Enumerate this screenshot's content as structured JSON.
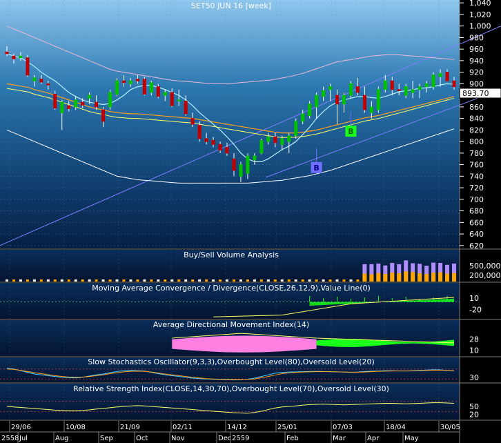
{
  "chart_data": {
    "type": "candlestick",
    "title": "SET50 JUN 16   [week]",
    "last_price_label": "893.70",
    "price_axis": {
      "ylim": [
        615,
        1045
      ],
      "ticks": [
        "1,040",
        "1,020",
        "1,000",
        "980",
        "960",
        "940",
        "920",
        "900",
        "880",
        "860",
        "840",
        "820",
        "800",
        "780",
        "760",
        "740",
        "720",
        "700",
        "680",
        "660",
        "640",
        "620"
      ],
      "tick_values": [
        1040,
        1020,
        1000,
        980,
        960,
        940,
        920,
        900,
        880,
        860,
        840,
        820,
        800,
        780,
        760,
        740,
        720,
        700,
        680,
        660,
        640,
        620
      ]
    },
    "x_axis": {
      "date_labels": [
        "29/06",
        "10/08",
        "21/09",
        "02/11",
        "14/12",
        "25/01",
        "07/03",
        "18/04",
        "30/05"
      ],
      "month_labels": [
        "Jul",
        "Aug",
        "Sep",
        "Oct",
        "Nov",
        "Dec",
        "2559",
        "Feb",
        "Mar",
        "Apr",
        "May"
      ],
      "year_label": "2558"
    },
    "candles": [
      {
        "o": 955,
        "h": 965,
        "l": 948,
        "c": 952
      },
      {
        "o": 948,
        "h": 952,
        "l": 935,
        "c": 943
      },
      {
        "o": 945,
        "h": 955,
        "l": 940,
        "c": 948
      },
      {
        "o": 945,
        "h": 950,
        "l": 912,
        "c": 915
      },
      {
        "o": 905,
        "h": 915,
        "l": 895,
        "c": 910
      },
      {
        "o": 908,
        "h": 915,
        "l": 900,
        "c": 903
      },
      {
        "o": 900,
        "h": 905,
        "l": 890,
        "c": 898
      },
      {
        "o": 882,
        "h": 888,
        "l": 855,
        "c": 858
      },
      {
        "o": 850,
        "h": 872,
        "l": 820,
        "c": 868
      },
      {
        "o": 862,
        "h": 870,
        "l": 852,
        "c": 857
      },
      {
        "o": 860,
        "h": 878,
        "l": 855,
        "c": 872
      },
      {
        "o": 868,
        "h": 875,
        "l": 858,
        "c": 863
      },
      {
        "o": 875,
        "h": 885,
        "l": 865,
        "c": 880
      },
      {
        "o": 868,
        "h": 880,
        "l": 855,
        "c": 860
      },
      {
        "o": 855,
        "h": 860,
        "l": 825,
        "c": 835
      },
      {
        "o": 860,
        "h": 890,
        "l": 855,
        "c": 885
      },
      {
        "o": 882,
        "h": 910,
        "l": 878,
        "c": 905
      },
      {
        "o": 905,
        "h": 915,
        "l": 895,
        "c": 902
      },
      {
        "o": 900,
        "h": 910,
        "l": 895,
        "c": 905
      },
      {
        "o": 908,
        "h": 915,
        "l": 900,
        "c": 905
      },
      {
        "o": 908,
        "h": 912,
        "l": 880,
        "c": 882
      },
      {
        "o": 885,
        "h": 905,
        "l": 880,
        "c": 902
      },
      {
        "o": 895,
        "h": 900,
        "l": 875,
        "c": 878
      },
      {
        "o": 880,
        "h": 890,
        "l": 870,
        "c": 885
      },
      {
        "o": 885,
        "h": 892,
        "l": 860,
        "c": 862
      },
      {
        "o": 870,
        "h": 890,
        "l": 862,
        "c": 872
      },
      {
        "o": 870,
        "h": 880,
        "l": 845,
        "c": 848
      },
      {
        "o": 840,
        "h": 850,
        "l": 825,
        "c": 830
      },
      {
        "o": 828,
        "h": 835,
        "l": 800,
        "c": 805
      },
      {
        "o": 805,
        "h": 815,
        "l": 795,
        "c": 800
      },
      {
        "o": 802,
        "h": 808,
        "l": 790,
        "c": 795
      },
      {
        "o": 795,
        "h": 800,
        "l": 780,
        "c": 785
      },
      {
        "o": 790,
        "h": 798,
        "l": 775,
        "c": 780
      },
      {
        "o": 770,
        "h": 780,
        "l": 740,
        "c": 750
      },
      {
        "o": 740,
        "h": 765,
        "l": 730,
        "c": 760
      },
      {
        "o": 745,
        "h": 780,
        "l": 735,
        "c": 775
      },
      {
        "o": 768,
        "h": 780,
        "l": 760,
        "c": 775
      },
      {
        "o": 780,
        "h": 805,
        "l": 778,
        "c": 802
      },
      {
        "o": 800,
        "h": 815,
        "l": 795,
        "c": 808
      },
      {
        "o": 808,
        "h": 815,
        "l": 790,
        "c": 798
      },
      {
        "o": 795,
        "h": 810,
        "l": 785,
        "c": 805
      },
      {
        "o": 800,
        "h": 815,
        "l": 780,
        "c": 810
      },
      {
        "o": 810,
        "h": 840,
        "l": 805,
        "c": 835
      },
      {
        "o": 835,
        "h": 855,
        "l": 830,
        "c": 848
      },
      {
        "o": 845,
        "h": 870,
        "l": 840,
        "c": 865
      },
      {
        "o": 860,
        "h": 885,
        "l": 840,
        "c": 880
      },
      {
        "o": 878,
        "h": 895,
        "l": 870,
        "c": 888
      },
      {
        "o": 890,
        "h": 900,
        "l": 870,
        "c": 895
      },
      {
        "o": 880,
        "h": 890,
        "l": 830,
        "c": 865
      },
      {
        "o": 865,
        "h": 885,
        "l": 850,
        "c": 880
      },
      {
        "o": 880,
        "h": 905,
        "l": 875,
        "c": 900
      },
      {
        "o": 895,
        "h": 910,
        "l": 880,
        "c": 885
      },
      {
        "o": 880,
        "h": 895,
        "l": 850,
        "c": 855
      },
      {
        "o": 850,
        "h": 870,
        "l": 840,
        "c": 860
      },
      {
        "o": 855,
        "h": 895,
        "l": 850,
        "c": 890
      },
      {
        "o": 890,
        "h": 915,
        "l": 885,
        "c": 905
      },
      {
        "o": 905,
        "h": 912,
        "l": 880,
        "c": 890
      },
      {
        "o": 890,
        "h": 900,
        "l": 880,
        "c": 888
      },
      {
        "o": 880,
        "h": 900,
        "l": 875,
        "c": 895
      },
      {
        "o": 885,
        "h": 905,
        "l": 875,
        "c": 890
      },
      {
        "o": 890,
        "h": 900,
        "l": 875,
        "c": 895
      },
      {
        "o": 895,
        "h": 905,
        "l": 885,
        "c": 900
      },
      {
        "o": 895,
        "h": 920,
        "l": 890,
        "c": 915
      },
      {
        "o": 912,
        "h": 925,
        "l": 895,
        "c": 918
      },
      {
        "o": 920,
        "h": 925,
        "l": 905,
        "c": 905
      },
      {
        "o": 905,
        "h": 912,
        "l": 890,
        "c": 895
      }
    ],
    "ma_fast": [
      952,
      948,
      945,
      938,
      930,
      920,
      912,
      905,
      895,
      885,
      878,
      872,
      868,
      866,
      864,
      866,
      872,
      880,
      890,
      895,
      897,
      897,
      894,
      890,
      885,
      880,
      872,
      862,
      850,
      840,
      830,
      820,
      808,
      795,
      780,
      770,
      765,
      765,
      770,
      778,
      786,
      792,
      800,
      812,
      825,
      840,
      852,
      862,
      868,
      872,
      875,
      878,
      878,
      876,
      875,
      878,
      882,
      886,
      888,
      890,
      892,
      893,
      895,
      898,
      900,
      899
    ],
    "ma_slow": [
      900,
      898,
      896,
      894,
      890,
      887,
      884,
      880,
      876,
      872,
      868,
      864,
      860,
      857,
      855,
      852,
      850,
      849,
      848,
      848,
      847,
      846,
      845,
      844,
      843,
      842,
      841,
      840,
      838,
      836,
      834,
      832,
      830,
      828,
      826,
      824,
      822,
      820,
      818,
      816,
      815,
      815,
      815,
      816,
      818,
      820,
      823,
      826,
      829,
      832,
      835,
      838,
      841,
      843,
      845,
      848,
      851,
      854,
      857,
      860,
      863,
      866,
      869,
      872,
      875,
      878
    ],
    "bollinger_upper": [
      1000,
      995,
      990,
      985,
      980,
      975,
      970,
      965,
      960,
      955,
      950,
      945,
      940,
      935,
      930,
      925,
      922,
      920,
      918,
      916,
      914,
      912,
      910,
      908,
      906,
      905,
      904,
      903,
      902,
      901,
      900,
      900,
      900,
      901,
      902,
      903,
      904,
      905,
      906,
      908,
      910,
      912,
      915,
      918,
      922,
      926,
      930,
      934,
      938,
      940,
      942,
      944,
      946,
      948,
      949,
      950,
      950,
      950,
      949,
      948,
      947,
      946,
      945,
      944,
      943,
      942
    ],
    "bollinger_lower": [
      820,
      815,
      810,
      805,
      800,
      795,
      790,
      785,
      780,
      775,
      770,
      765,
      760,
      755,
      750,
      745,
      740,
      738,
      736,
      734,
      733,
      732,
      731,
      730,
      729,
      728,
      728,
      728,
      728,
      728,
      728,
      728,
      728,
      728,
      728,
      728,
      729,
      730,
      731,
      732,
      733,
      735,
      737,
      739,
      741,
      744,
      747,
      750,
      754,
      758,
      762,
      766,
      770,
      774,
      778,
      782,
      786,
      790,
      794,
      798,
      802,
      806,
      810,
      814,
      818,
      822
    ],
    "trend_upper": [
      [
        0,
        620
      ],
      [
        726,
        1000
      ]
    ],
    "trend_lower": [
      [
        385,
        738
      ],
      [
        726,
        890
      ]
    ],
    "signals": [
      {
        "label": "B",
        "price": 755,
        "index": 45,
        "color": "#6f6fff",
        "text_color": "#000080"
      },
      {
        "label": "B",
        "price": 818,
        "index": 50,
        "color": "#19ff19",
        "text_color": "#006600"
      }
    ],
    "volume": {
      "title": "Buy/Sell Volume Analysis",
      "ticks": [
        "500,000",
        "200,000"
      ],
      "tick_values": [
        500000,
        200000
      ],
      "ylim": [
        0,
        700000
      ],
      "bars_index_start": 52,
      "buy": [
        250000,
        230000,
        270000,
        240000,
        280000,
        260000,
        320000,
        300000,
        260000,
        240000,
        280000,
        290000,
        250000,
        270000
      ],
      "sell": [
        300000,
        320000,
        300000,
        270000,
        310000,
        290000,
        350000,
        280000,
        300000,
        260000,
        320000,
        300000,
        280000,
        300000
      ]
    },
    "macd": {
      "title": "Moving Average Convergence / Divergence(CLOSE,26,12,9),Value Line(0)",
      "ticks": [
        "10",
        "-20"
      ],
      "tick_values": [
        10,
        -20
      ],
      "ylim": [
        -45,
        25
      ]
    },
    "adx": {
      "title": "Average Directional Movement Index(14)",
      "ticks": [
        "28",
        "10"
      ],
      "tick_values": [
        28,
        10
      ],
      "ylim": [
        0,
        45
      ]
    },
    "stoch": {
      "title": "Slow Stochastics Oscillator(9,3,3),Overbought Level(80),Oversold Level(20)",
      "ticks": [
        "30"
      ],
      "tick_values": [
        30
      ],
      "ylim": [
        0,
        100
      ],
      "k": [
        85,
        80,
        70,
        60,
        50,
        45,
        40,
        35,
        30,
        28,
        26,
        30,
        38,
        45,
        50,
        58,
        65,
        70,
        72,
        70,
        68,
        60,
        52,
        45,
        40,
        35,
        30,
        25,
        22,
        20,
        18,
        16,
        15,
        14,
        15,
        18,
        25,
        35,
        45,
        55,
        60,
        62,
        63,
        64,
        65,
        66,
        65,
        64,
        63,
        62,
        60,
        62,
        65,
        67,
        68,
        70,
        70,
        69,
        68,
        70,
        72,
        74,
        76,
        75,
        72,
        70
      ],
      "d": [
        80,
        78,
        72,
        65,
        58,
        52,
        46,
        40,
        35,
        32,
        30,
        31,
        35,
        40,
        45,
        52,
        58,
        63,
        66,
        67,
        66,
        62,
        56,
        50,
        45,
        40,
        35,
        30,
        26,
        22,
        20,
        18,
        17,
        16,
        16,
        17,
        20,
        27,
        35,
        44,
        52,
        57,
        60,
        62,
        63,
        64,
        64,
        64,
        63,
        62,
        61,
        61,
        62,
        64,
        66,
        67,
        68,
        68,
        68,
        69,
        70,
        72,
        73,
        73,
        72,
        71
      ]
    },
    "rsi": {
      "title": "Relative Strength Index(CLOSE,14,30,70),Overbought Level(70),Oversold Level(30)",
      "ticks": [
        "50",
        "20"
      ],
      "tick_values": [
        50,
        20
      ],
      "ylim": [
        0,
        100
      ],
      "values": [
        50,
        48,
        46,
        44,
        42,
        40,
        38,
        36,
        35,
        34,
        34,
        35,
        37,
        40,
        42,
        45,
        48,
        50,
        52,
        53,
        52,
        50,
        48,
        46,
        44,
        42,
        40,
        38,
        36,
        34,
        32,
        30,
        28,
        26,
        25,
        24,
        27,
        32,
        38,
        44,
        48,
        50,
        52,
        55,
        57,
        58,
        59,
        58,
        57,
        56,
        57,
        58,
        59,
        60,
        61,
        62,
        62,
        61,
        60,
        61,
        62,
        63,
        64,
        64,
        63,
        62
      ]
    }
  }
}
